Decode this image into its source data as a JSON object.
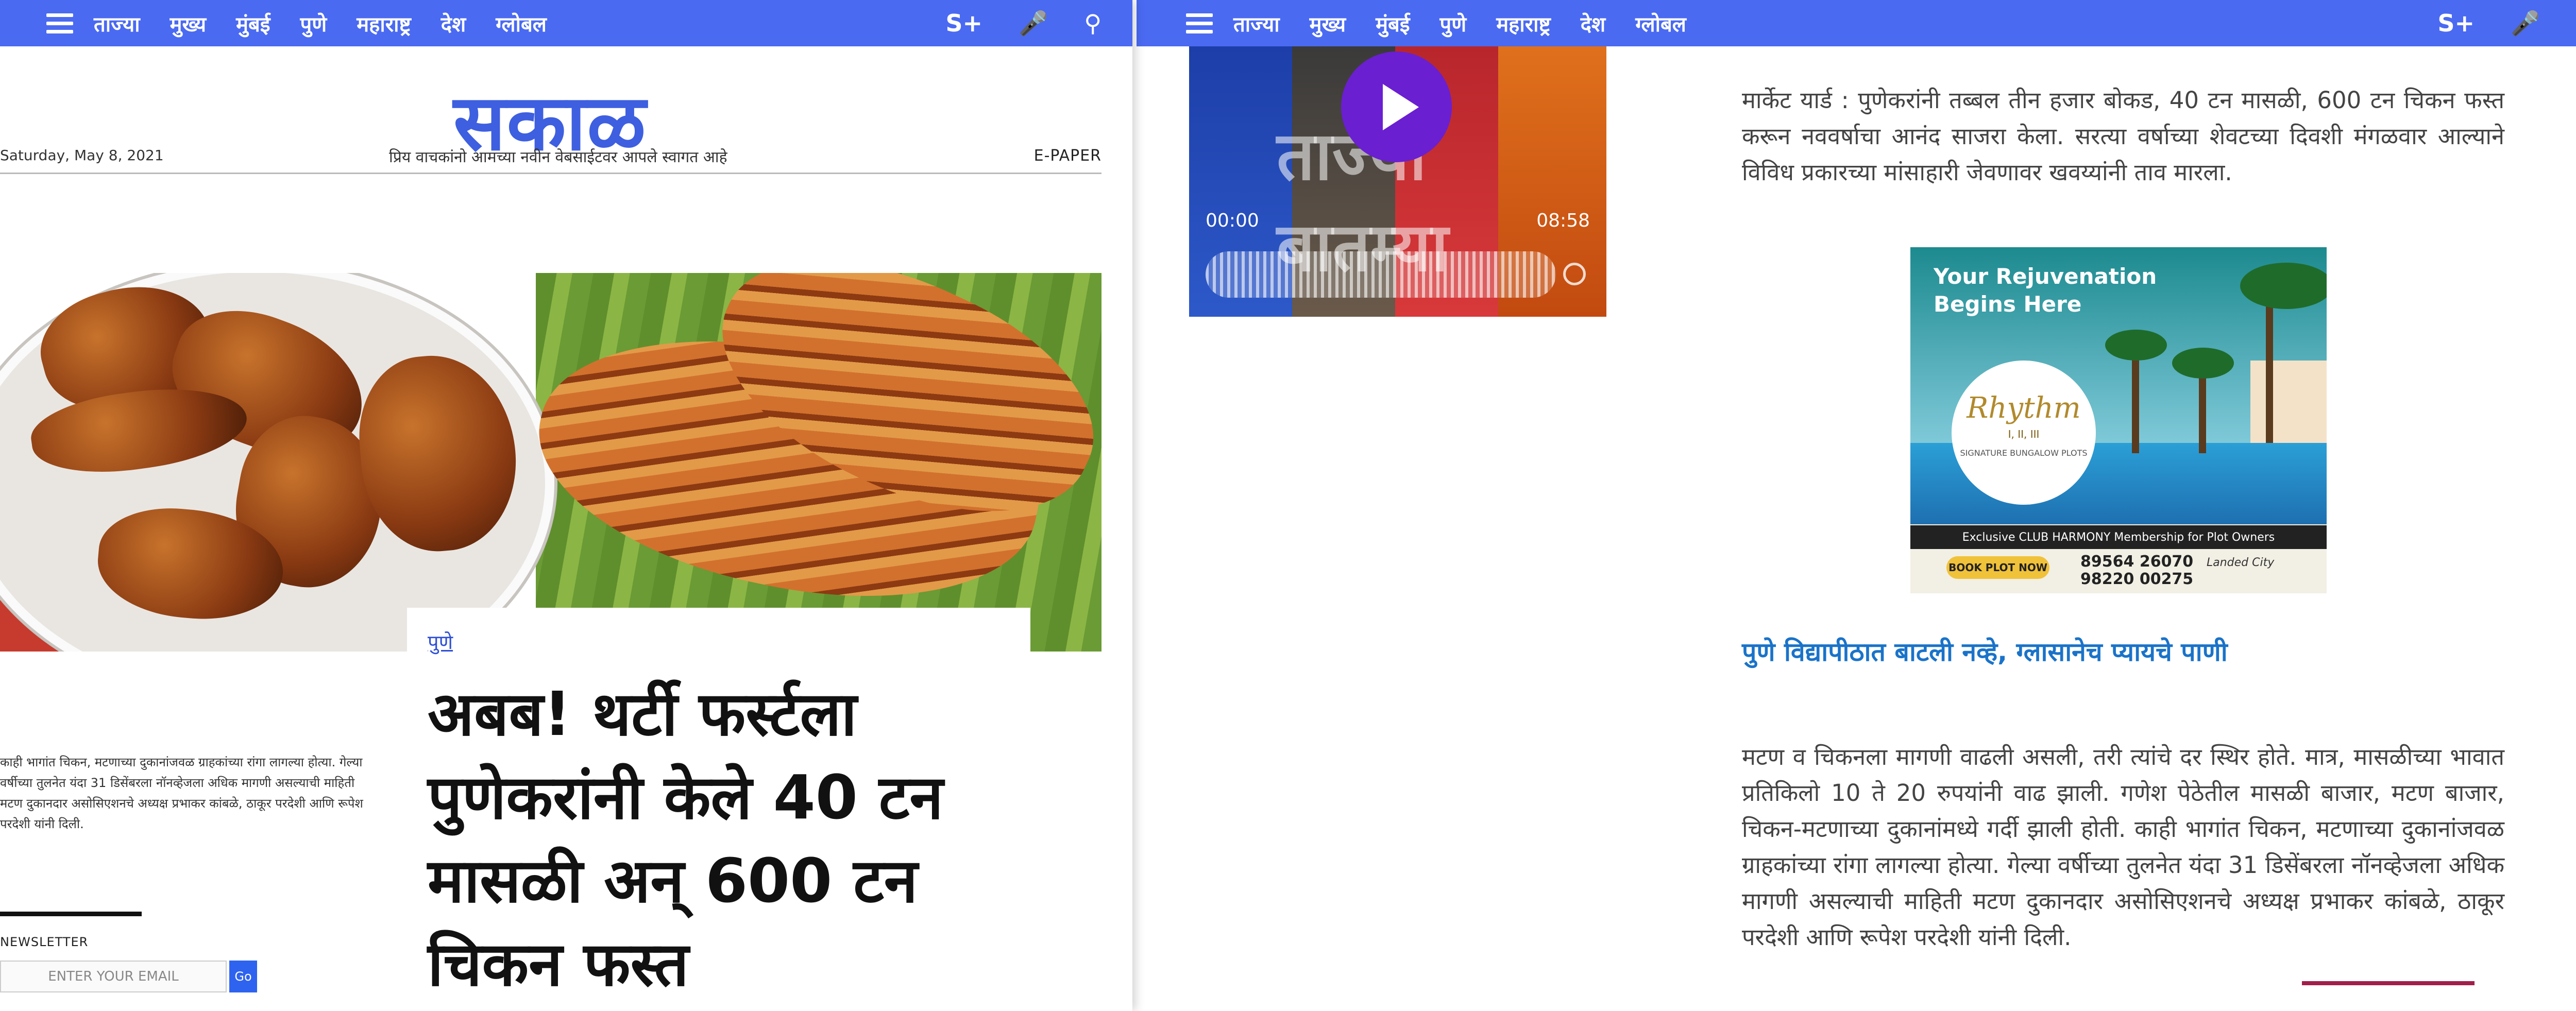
{
  "nav": {
    "items": [
      "ताज्या",
      "मुख्य",
      "मुंबई",
      "पुणे",
      "महाराष्ट्र",
      "देश",
      "ग्लोबल"
    ],
    "right_icons": [
      "S+",
      "mic-icon",
      "search-icon"
    ],
    "right_labels": {
      "splus": "S+",
      "mic": "🎤",
      "search": "⚲"
    },
    "color": "#4a6af2"
  },
  "masthead": {
    "logo": "सकाळ",
    "date": "Saturday, May 8, 2021",
    "tagline": "प्रिय वाचकांनो आमच्या नवीन वेबसाईटवर आपले स्वागत आहे",
    "epaper": "E-PAPER",
    "logo_color": "#3d5fe0"
  },
  "article": {
    "category": "पुणे",
    "headline": "अबब! थर्टी फर्स्टला पुणेकरांनी केले 40 टन मासळी अन् 600 टन चिकन फस्त",
    "excerpt": "काही भागांत चिकन, मटणाच्या दुकानांजवळ ग्राहकांच्या रांगा लागल्या होत्या. गेल्या वर्षीच्या तुलनेत यंदा 31 डिसेंबरला नॉनव्हेजला अधिक मागणी असल्याची माहिती मटण दुकानदार असोसिएशनचे अध्यक्ष प्रभाकर कांबळे, ठाकूर परदेशी आणि रूपेश परदेशी यांनी दिली."
  },
  "newsletter": {
    "label": "NEWSLETTER",
    "placeholder": "ENTER YOUR EMAIL",
    "button": "Go"
  },
  "video": {
    "title": "ताज्या बातम्या",
    "current_time": "00:00",
    "duration": "08:58"
  },
  "right_article": {
    "para1": "मार्केट यार्ड : पुणेकरांनी तब्बल तीन हजार बोकड, 40 टन मासळी, 600 टन चिकन फस्त करून नववर्षाचा आनंद साजरा केला. सरत्या वर्षाच्या शेवटच्या दिवशी मंगळवार आल्याने विविध प्रकारच्या मांसाहारी जेवणावर खवय्यांनी ताव मारला.",
    "related_link": "पुणे विद्यापीठात बाटली नव्हे, ग्लासानेच प्यायचे पाणी",
    "para2": "मटण व चिकनला मागणी वाढली असली, तरी त्यांचे दर स्थिर होते. मात्र, मासळीच्या भावात प्रतिकिलो 10 ते 20 रुपयांनी वाढ झाली. गणेश पेठेतील मासळी बाजार, मटण बाजार, चिकन-मटणाच्या दुकानांमध्ये गर्दी झाली होती. काही भागांत चिकन, मटणाच्या दुकानांजवळ ग्राहकांच्या रांगा लागल्या होत्या. गेल्या वर्षीच्या तुलनेत यंदा 31 डिसेंबरला नॉनव्हेजला अधिक मागणी असल्याची माहिती मटण दुकानदार असोसिएशनचे अध्यक्ष प्रभाकर कांबळे, ठाकूर परदेशी आणि रूपेश परदेशी यांनी दिली."
  },
  "ad": {
    "headline_1": "Your Rejuvenation",
    "headline_2": "Begins Here",
    "brand": "Rhythm",
    "phases": "I, II, III",
    "product": "SIGNATURE BUNGALOW PLOTS",
    "strip": "Exclusive CLUB HARMONY Membership for Plot Owners",
    "cta": "BOOK PLOT NOW",
    "phone_1": "89564 26070",
    "phone_2": "98220 00275",
    "developer": "Landed City"
  }
}
